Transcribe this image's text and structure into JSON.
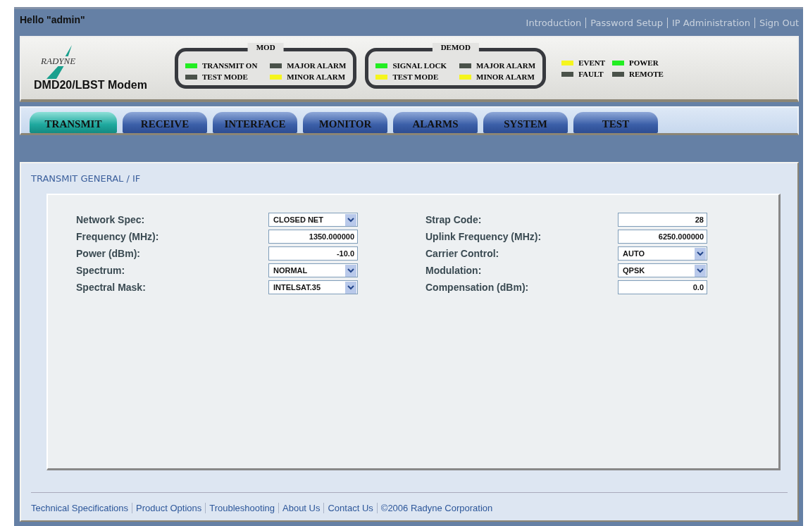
{
  "greeting": "Hello \"admin\"",
  "top_links": [
    "Introduction",
    "Password Setup",
    "IP Administration",
    "Sign Out"
  ],
  "logo": "RADYNE",
  "model": "DMD20/LBST Modem",
  "led_groups": [
    {
      "title": "MOD",
      "leds": [
        {
          "label": "TRANSMIT ON",
          "color": "#22ee22"
        },
        {
          "label": "MAJOR ALARM",
          "color": "#4a524a"
        },
        {
          "label": "TEST MODE",
          "color": "#4a524a"
        },
        {
          "label": "MINOR ALARM",
          "color": "#f5f51e"
        }
      ]
    },
    {
      "title": "DEMOD",
      "leds": [
        {
          "label": "SIGNAL LOCK",
          "color": "#22ee22"
        },
        {
          "label": "MAJOR ALARM",
          "color": "#4a524a"
        },
        {
          "label": "TEST MODE",
          "color": "#f5f51e"
        },
        {
          "label": "MINOR ALARM",
          "color": "#f5f51e"
        }
      ]
    },
    {
      "leds": [
        {
          "label": "EVENT",
          "color": "#f5f51e"
        },
        {
          "label": "POWER",
          "color": "#22ee22"
        },
        {
          "label": "FAULT",
          "color": "#4a524a"
        },
        {
          "label": "REMOTE",
          "color": "#4a524a"
        }
      ]
    }
  ],
  "tabs": [
    {
      "label": "TRANSMIT",
      "selected": true
    },
    {
      "label": "RECEIVE",
      "selected": false
    },
    {
      "label": "INTERFACE",
      "selected": false
    },
    {
      "label": "MONITOR",
      "selected": false
    },
    {
      "label": "ALARMS",
      "selected": false
    },
    {
      "label": "SYSTEM",
      "selected": false
    },
    {
      "label": "TEST",
      "selected": false
    }
  ],
  "section_title": "TRANSMIT GENERAL / IF",
  "form_columns": [
    [
      {
        "label": "Network Spec:",
        "kind": "select",
        "value": "CLOSED NET"
      },
      {
        "label": "Frequency (MHz):",
        "kind": "text",
        "value": "1350.000000"
      },
      {
        "label": "Power (dBm):",
        "kind": "text",
        "value": "-10.0"
      },
      {
        "label": "Spectrum:",
        "kind": "select",
        "value": "NORMAL"
      },
      {
        "label": "Spectral Mask:",
        "kind": "select",
        "value": "INTELSAT.35"
      }
    ],
    [
      {
        "label": "Strap Code:",
        "kind": "text",
        "value": "28"
      },
      {
        "label": "Uplink Frequency (MHz):",
        "kind": "text",
        "value": "6250.000000"
      },
      {
        "label": "Carrier Control:",
        "kind": "select",
        "value": "AUTO"
      },
      {
        "label": "Modulation:",
        "kind": "select",
        "value": "QPSK"
      },
      {
        "label": "Compensation (dBm):",
        "kind": "text",
        "value": "0.0"
      }
    ]
  ],
  "footer_links": [
    "Technical Specifications",
    "Product Options",
    "Troubleshooting",
    "About Us",
    "Contact Us",
    "©2006 Radyne Corporation"
  ]
}
